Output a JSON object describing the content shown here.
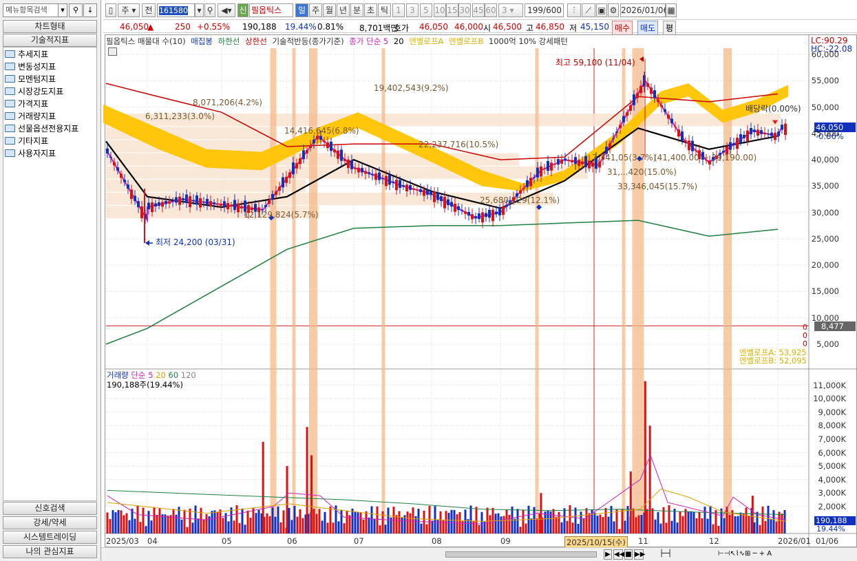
{
  "left_panel": {
    "search_placeholder": "메뉴항목검색",
    "chart_type_tab": "차트형태",
    "indicator_tab": "기술적지표",
    "folders": [
      "추세지표",
      "변동성지표",
      "모멘텀지표",
      "시장강도지표",
      "가격지표",
      "거래량지표",
      "선물옵션전용지표",
      "기타지표",
      "사용자지표"
    ],
    "bottom_tabs": [
      "신호검색",
      "강세/약세",
      "시스템트레이딩",
      "나의 관심지표"
    ]
  },
  "toolbar": {
    "period_label": "주",
    "prev_label": "전",
    "code": "161580",
    "credit_label": "신",
    "stock_name": "필옵틱스",
    "period_buttons": [
      "일",
      "주",
      "월",
      "년",
      "분",
      "초",
      "틱"
    ],
    "interval_buttons": [
      "1",
      "3",
      "5",
      "10",
      "15",
      "30",
      "45",
      "60"
    ],
    "interval_value": "3",
    "count_value": "199",
    "count_total": "/600",
    "date_value": "2026/01/06"
  },
  "price_bar": {
    "price": "46,050",
    "change": "250",
    "change_pct": "+0.55%",
    "volume": "190,188",
    "volume_pct": "19.44%",
    "turnover_pct": "0.81%",
    "trade_value": "8,701백만",
    "ask_label": "호가",
    "ask1": "46,050",
    "ask2": "46,000",
    "open_label": "시",
    "open": "46,500",
    "high_label": "고",
    "high": "46,850",
    "low_label": "저",
    "low": "45,150",
    "buy_label": "매수",
    "sell_label": "매도",
    "avg_label": "평"
  },
  "price_legend": {
    "main": "필옵틱스 매물대 수(10)",
    "candle": "매집봉",
    "lower": "하한선",
    "upper": "상한선",
    "tech": "기술적반등(종가기준)",
    "ma": "종가 단순 5",
    "ma20": "20",
    "envA": "엔벨로프A",
    "envB": "엔벨로프B",
    "strong": "1000억 10% 강세패턴"
  },
  "volume_legend": {
    "title": "거래량",
    "ma": "단순 5",
    "ma20": "20",
    "ma60": "60",
    "ma120": "120",
    "value": "190,188주(19.44%)"
  },
  "annotations": {
    "high": "최고 59,100 (11/04)",
    "low": "최저 24,200 (03/31)",
    "dividend": "배당락(0.00%)",
    "lc": "LC:90.29",
    "hc": "HC:-22.08",
    "current_price": "46,050",
    "current_pct": "-0.86%",
    "line_price": "8,477",
    "env_a": "엔벨로프A: 53,925",
    "env_b": "엔벨로프B: 52,095",
    "vol_current": "190,188",
    "vol_pct": "19.44%",
    "vp": [
      {
        "text": "19,402,543(9.2%)"
      },
      {
        "text": "8,071,206(4.2%)"
      },
      {
        "text": "6,311,233(3.0%)"
      },
      {
        "text": "14,416,645(6.8%)"
      },
      {
        "text": "22,237,716(10.5%)"
      },
      {
        "text": "7,741,05(3.7%)"
      },
      {
        "text": "(41,400.00 ~ 39,190.00)"
      },
      {
        "text": "31,...420(15.0%)"
      },
      {
        "text": "33,346,045(15.7%)"
      },
      {
        "text": "25,680,229(12.1%)"
      },
      {
        "text": "12,129,824(5.7%)"
      }
    ],
    "zeros": [
      "0",
      "0",
      "0"
    ]
  },
  "axes": {
    "price_ticks": [
      "60,000",
      "55,000",
      "50,000",
      "45,000",
      "40,000",
      "35,000",
      "30,000",
      "25,000",
      "20,000",
      "15,000",
      "10,000",
      "5,000"
    ],
    "volume_ticks": [
      "11,000K",
      "10,000K",
      "9,000K",
      "8,000K",
      "7,000K",
      "6,000K",
      "5,000K",
      "4,000K",
      "3,000K",
      "2,000K"
    ],
    "x_labels": [
      "2025/03",
      "04",
      "05",
      "06",
      "07",
      "08",
      "09",
      "2025/10/15(수)",
      "11",
      "12",
      "2026/01"
    ],
    "corner_date": "01/06"
  },
  "colors": {
    "up": "#e01010",
    "down": "#1030c0",
    "ma5": "#d020c0",
    "ma20": "#000000",
    "ma120": "#208040",
    "env": "#ffc400",
    "upper": "#cc0000",
    "volband": "#f5b98a"
  },
  "chart_data": {
    "type": "candlestick",
    "symbol": "필옵틱스",
    "code": "161580",
    "x_range": [
      "2025/03",
      "2026/01"
    ],
    "ylim": [
      5000,
      60000
    ],
    "close_series": {
      "name": "종가",
      "points": [
        [
          "2025/03",
          42000
        ],
        [
          "2025/03/31",
          28500
        ],
        [
          "2025/04",
          31000
        ],
        [
          "2025/04/15",
          32500
        ],
        [
          "2025/05",
          31500
        ],
        [
          "2025/05/20",
          30500
        ],
        [
          "2025/06",
          36500
        ],
        [
          "2025/06/15",
          44500
        ],
        [
          "2025/07",
          38500
        ],
        [
          "2025/07/20",
          35000
        ],
        [
          "2025/08",
          33500
        ],
        [
          "2025/08/20",
          29000
        ],
        [
          "2025/09",
          30000
        ],
        [
          "2025/09/20",
          38000
        ],
        [
          "2025/10",
          40000
        ],
        [
          "2025/10/15",
          39000
        ],
        [
          "2025/11/04",
          55000
        ],
        [
          "2025/11/20",
          44000
        ],
        [
          "2025/12",
          39500
        ],
        [
          "2025/12/20",
          45500
        ],
        [
          "2026/01",
          44500
        ],
        [
          "2026/01/06",
          46050
        ]
      ]
    },
    "ma20_series": {
      "name": "20",
      "points": [
        [
          "2025/03",
          43500
        ],
        [
          "2025/04",
          33000
        ],
        [
          "2025/05",
          31000
        ],
        [
          "2025/06",
          33000
        ],
        [
          "2025/07",
          40000
        ],
        [
          "2025/08",
          34000
        ],
        [
          "2025/09",
          30800
        ],
        [
          "2025/10",
          36000
        ],
        [
          "2025/11",
          46000
        ],
        [
          "2025/12",
          42000
        ],
        [
          "2026/01",
          44500
        ]
      ]
    },
    "ma120_series": {
      "name": "120",
      "points": [
        [
          "2025/03",
          5000
        ],
        [
          "2025/04",
          8000
        ],
        [
          "2025/05",
          16000
        ],
        [
          "2025/06",
          23000
        ],
        [
          "2025/07",
          27000
        ],
        [
          "2025/08",
          27500
        ],
        [
          "2025/09",
          27500
        ],
        [
          "2025/10",
          28000
        ],
        [
          "2025/11",
          28500
        ],
        [
          "2025/12",
          25500
        ],
        [
          "2026/01",
          26800
        ]
      ]
    },
    "envelope_upper": {
      "name": "엔벨로프A",
      "value": 53925
    },
    "envelope_lower": {
      "name": "엔벨로프B",
      "value": 52095
    },
    "upper_line": {
      "name": "상한선",
      "points": [
        [
          "2025/03",
          54500
        ],
        [
          "2025/04",
          52500
        ],
        [
          "2025/05",
          49000
        ],
        [
          "2025/06",
          42500
        ],
        [
          "2025/07",
          43000
        ],
        [
          "2025/08",
          43000
        ],
        [
          "2025/09",
          40000
        ],
        [
          "2025/10",
          40500
        ],
        [
          "2025/11",
          52000
        ],
        [
          "2025/12",
          51000
        ],
        [
          "2026/01",
          52500
        ]
      ]
    },
    "volume_series": {
      "name": "거래량",
      "spikes": [
        [
          "2025/05/20",
          6800
        ],
        [
          "2025/06/01",
          5000
        ],
        [
          "2025/06/10",
          7900
        ],
        [
          "2025/06/12",
          5800
        ],
        [
          "2025/09/20",
          3000
        ],
        [
          "2025/10/28",
          4600
        ],
        [
          "2025/11/04",
          11300
        ],
        [
          "2025/11/06",
          8000
        ],
        [
          "2025/12/20",
          2800
        ]
      ],
      "unit": "K주",
      "ylim": [
        0,
        12000
      ]
    },
    "markers": {
      "high": 59100,
      "high_date": "11/04",
      "low": 24200,
      "low_date": "03/31"
    }
  }
}
